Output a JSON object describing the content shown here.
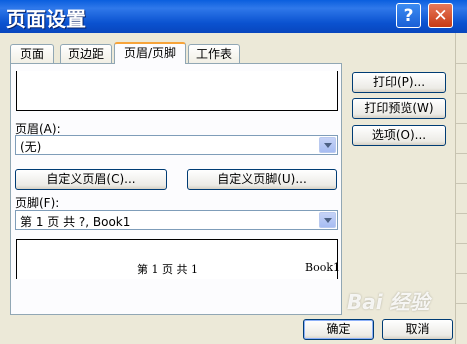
{
  "window": {
    "title": "页面设置",
    "help_glyph": "?",
    "close_glyph": "✕"
  },
  "tabs": [
    {
      "label": "页面"
    },
    {
      "label": "页边距"
    },
    {
      "label": "页眉/页脚"
    },
    {
      "label": "工作表"
    }
  ],
  "header": {
    "label": "页眉(A):",
    "value": "(无)",
    "custom_button": "自定义页眉(C)..."
  },
  "footer": {
    "label": "页脚(F):",
    "value": "第 1 页  共 ?, Book1",
    "custom_button": "自定义页脚(U)...",
    "preview_center": "第 1 页  共 1",
    "preview_right": "Book1"
  },
  "side_buttons": {
    "print": "打印(P)...",
    "print_preview": "打印预览(W)",
    "options": "选项(O)..."
  },
  "bottom_buttons": {
    "ok": "确定",
    "cancel": "取消"
  },
  "watermark": "Bai 经验"
}
